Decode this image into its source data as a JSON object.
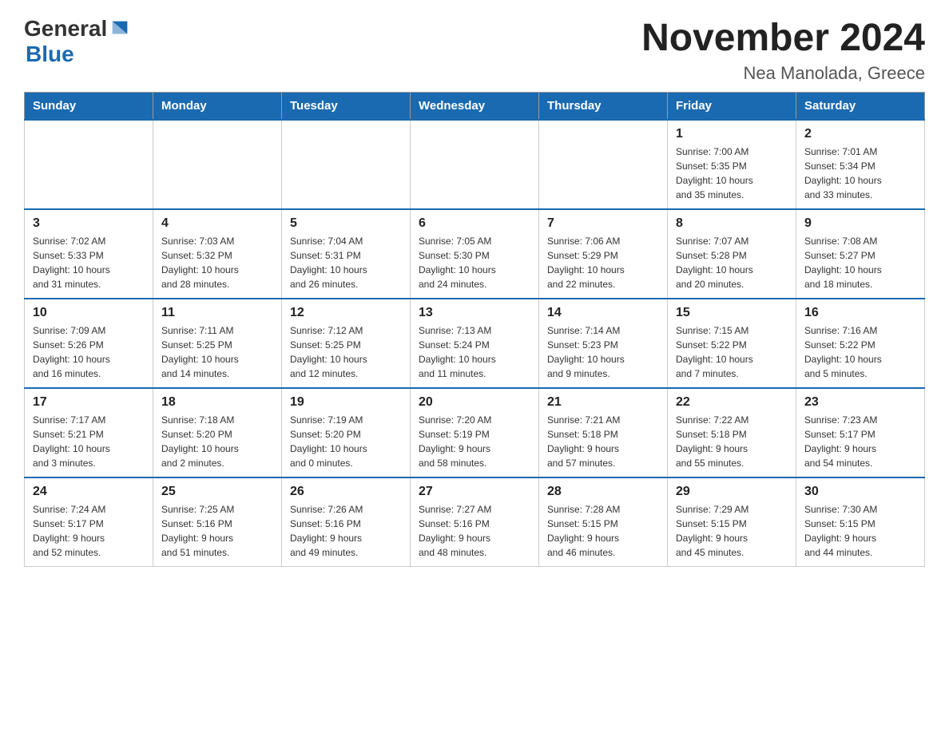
{
  "header": {
    "logo_general": "General",
    "logo_blue": "Blue",
    "month_title": "November 2024",
    "subtitle": "Nea Manolada, Greece"
  },
  "days_of_week": [
    "Sunday",
    "Monday",
    "Tuesday",
    "Wednesday",
    "Thursday",
    "Friday",
    "Saturday"
  ],
  "weeks": [
    [
      {
        "day": "",
        "info": ""
      },
      {
        "day": "",
        "info": ""
      },
      {
        "day": "",
        "info": ""
      },
      {
        "day": "",
        "info": ""
      },
      {
        "day": "",
        "info": ""
      },
      {
        "day": "1",
        "info": "Sunrise: 7:00 AM\nSunset: 5:35 PM\nDaylight: 10 hours\nand 35 minutes."
      },
      {
        "day": "2",
        "info": "Sunrise: 7:01 AM\nSunset: 5:34 PM\nDaylight: 10 hours\nand 33 minutes."
      }
    ],
    [
      {
        "day": "3",
        "info": "Sunrise: 7:02 AM\nSunset: 5:33 PM\nDaylight: 10 hours\nand 31 minutes."
      },
      {
        "day": "4",
        "info": "Sunrise: 7:03 AM\nSunset: 5:32 PM\nDaylight: 10 hours\nand 28 minutes."
      },
      {
        "day": "5",
        "info": "Sunrise: 7:04 AM\nSunset: 5:31 PM\nDaylight: 10 hours\nand 26 minutes."
      },
      {
        "day": "6",
        "info": "Sunrise: 7:05 AM\nSunset: 5:30 PM\nDaylight: 10 hours\nand 24 minutes."
      },
      {
        "day": "7",
        "info": "Sunrise: 7:06 AM\nSunset: 5:29 PM\nDaylight: 10 hours\nand 22 minutes."
      },
      {
        "day": "8",
        "info": "Sunrise: 7:07 AM\nSunset: 5:28 PM\nDaylight: 10 hours\nand 20 minutes."
      },
      {
        "day": "9",
        "info": "Sunrise: 7:08 AM\nSunset: 5:27 PM\nDaylight: 10 hours\nand 18 minutes."
      }
    ],
    [
      {
        "day": "10",
        "info": "Sunrise: 7:09 AM\nSunset: 5:26 PM\nDaylight: 10 hours\nand 16 minutes."
      },
      {
        "day": "11",
        "info": "Sunrise: 7:11 AM\nSunset: 5:25 PM\nDaylight: 10 hours\nand 14 minutes."
      },
      {
        "day": "12",
        "info": "Sunrise: 7:12 AM\nSunset: 5:25 PM\nDaylight: 10 hours\nand 12 minutes."
      },
      {
        "day": "13",
        "info": "Sunrise: 7:13 AM\nSunset: 5:24 PM\nDaylight: 10 hours\nand 11 minutes."
      },
      {
        "day": "14",
        "info": "Sunrise: 7:14 AM\nSunset: 5:23 PM\nDaylight: 10 hours\nand 9 minutes."
      },
      {
        "day": "15",
        "info": "Sunrise: 7:15 AM\nSunset: 5:22 PM\nDaylight: 10 hours\nand 7 minutes."
      },
      {
        "day": "16",
        "info": "Sunrise: 7:16 AM\nSunset: 5:22 PM\nDaylight: 10 hours\nand 5 minutes."
      }
    ],
    [
      {
        "day": "17",
        "info": "Sunrise: 7:17 AM\nSunset: 5:21 PM\nDaylight: 10 hours\nand 3 minutes."
      },
      {
        "day": "18",
        "info": "Sunrise: 7:18 AM\nSunset: 5:20 PM\nDaylight: 10 hours\nand 2 minutes."
      },
      {
        "day": "19",
        "info": "Sunrise: 7:19 AM\nSunset: 5:20 PM\nDaylight: 10 hours\nand 0 minutes."
      },
      {
        "day": "20",
        "info": "Sunrise: 7:20 AM\nSunset: 5:19 PM\nDaylight: 9 hours\nand 58 minutes."
      },
      {
        "day": "21",
        "info": "Sunrise: 7:21 AM\nSunset: 5:18 PM\nDaylight: 9 hours\nand 57 minutes."
      },
      {
        "day": "22",
        "info": "Sunrise: 7:22 AM\nSunset: 5:18 PM\nDaylight: 9 hours\nand 55 minutes."
      },
      {
        "day": "23",
        "info": "Sunrise: 7:23 AM\nSunset: 5:17 PM\nDaylight: 9 hours\nand 54 minutes."
      }
    ],
    [
      {
        "day": "24",
        "info": "Sunrise: 7:24 AM\nSunset: 5:17 PM\nDaylight: 9 hours\nand 52 minutes."
      },
      {
        "day": "25",
        "info": "Sunrise: 7:25 AM\nSunset: 5:16 PM\nDaylight: 9 hours\nand 51 minutes."
      },
      {
        "day": "26",
        "info": "Sunrise: 7:26 AM\nSunset: 5:16 PM\nDaylight: 9 hours\nand 49 minutes."
      },
      {
        "day": "27",
        "info": "Sunrise: 7:27 AM\nSunset: 5:16 PM\nDaylight: 9 hours\nand 48 minutes."
      },
      {
        "day": "28",
        "info": "Sunrise: 7:28 AM\nSunset: 5:15 PM\nDaylight: 9 hours\nand 46 minutes."
      },
      {
        "day": "29",
        "info": "Sunrise: 7:29 AM\nSunset: 5:15 PM\nDaylight: 9 hours\nand 45 minutes."
      },
      {
        "day": "30",
        "info": "Sunrise: 7:30 AM\nSunset: 5:15 PM\nDaylight: 9 hours\nand 44 minutes."
      }
    ]
  ]
}
